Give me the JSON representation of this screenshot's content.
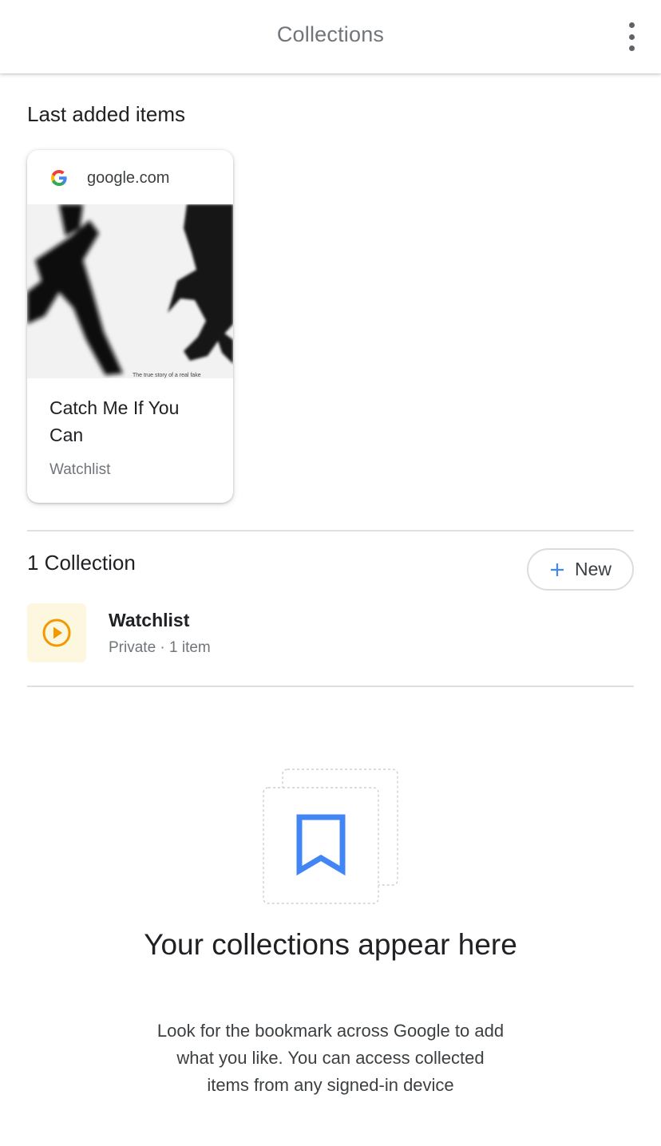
{
  "header": {
    "title": "Collections",
    "menu_icon": "more-vert-icon"
  },
  "last_added": {
    "heading": "Last added items",
    "items": [
      {
        "source_icon": "google-g-icon",
        "domain": "google.com",
        "title": "Catch Me If You Can",
        "collection": "Watchlist",
        "image_caption": "The true story of a real fake"
      }
    ]
  },
  "collections": {
    "heading": "1 Collection",
    "new_button_label": "New",
    "new_button_icon": "plus-icon",
    "items": [
      {
        "icon": "play-circle-icon",
        "name": "Watchlist",
        "meta": "Private · 1 item"
      }
    ]
  },
  "empty_state": {
    "icon": "bookmark-icon",
    "title": "Your collections appear here",
    "body": "Look for the bookmark across Google to add what you like. You can access collected items from any signed-in device"
  },
  "colors": {
    "accent_blue": "#4285f4",
    "watchlist_orange": "#f29900",
    "watchlist_bg": "#fef7e0"
  }
}
